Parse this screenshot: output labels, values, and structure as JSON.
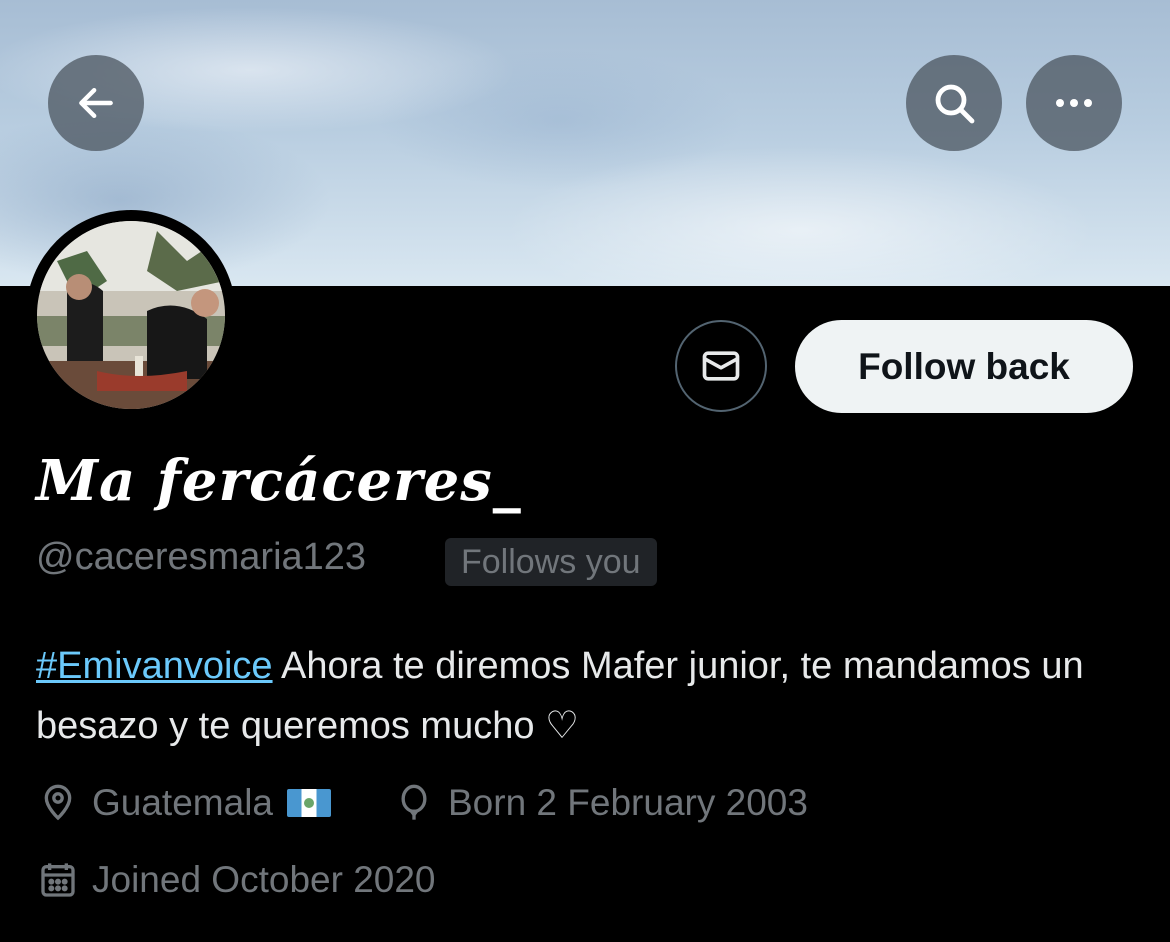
{
  "header": {
    "back_icon": "arrow-left-icon",
    "search_icon": "search-icon",
    "more_icon": "more-horizontal-icon"
  },
  "profile": {
    "display_name": "Ma fercáceres_",
    "handle": "@caceresmaria123",
    "follows_you_label": "Follows you",
    "follow_button_label": "Follow back",
    "message_icon": "envelope-icon",
    "bio_hashtag": "#Emivanvoice",
    "bio_text": " Ahora te diremos Mafer junior, te mandamos un besazo y te queremos mucho ♡",
    "location": "Guatemala",
    "location_flag": "guatemala-flag-emoji",
    "birthday": "Born 2 February 2003",
    "joined": "Joined October 2020"
  },
  "colors": {
    "background": "#000000",
    "button_light": "#eff3f4",
    "link": "#6bc9fb",
    "muted_text": "#71767b"
  }
}
